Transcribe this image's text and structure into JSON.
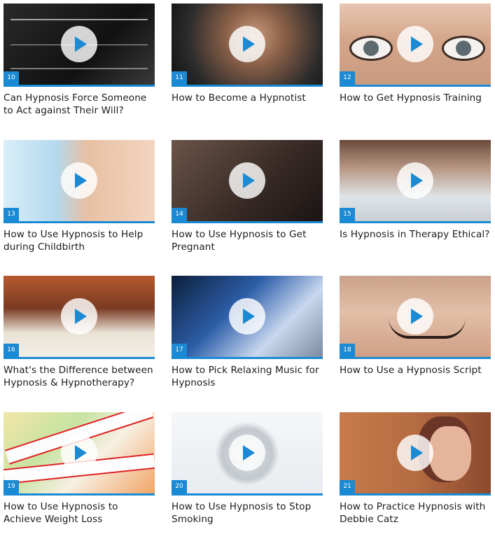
{
  "videos": [
    {
      "num": "10",
      "title": "Can Hypnosis Force Someone to Act against Their Will?"
    },
    {
      "num": "11",
      "title": "How to Become a Hypnotist"
    },
    {
      "num": "12",
      "title": "How to Get Hypnosis Training"
    },
    {
      "num": "13",
      "title": "How to Use Hypnosis to Help during Childbirth"
    },
    {
      "num": "14",
      "title": "How to Use Hypnosis to Get Pregnant"
    },
    {
      "num": "15",
      "title": "Is Hypnosis in Therapy Ethical?"
    },
    {
      "num": "16",
      "title": "What's the Difference between Hypnosis & Hypnotherapy?"
    },
    {
      "num": "17",
      "title": "How to Pick Relaxing Music for Hypnosis"
    },
    {
      "num": "18",
      "title": "How to Use a Hypnosis Script"
    },
    {
      "num": "19",
      "title": "How to Use Hypnosis to Achieve Weight Loss"
    },
    {
      "num": "20",
      "title": "How to Use Hypnosis to Stop Smoking"
    },
    {
      "num": "21",
      "title": "How to Practice Hypnosis with Debbie Catz"
    }
  ],
  "icons": {
    "play": "play-icon"
  },
  "colors": {
    "accent": "#1a8ad4"
  }
}
